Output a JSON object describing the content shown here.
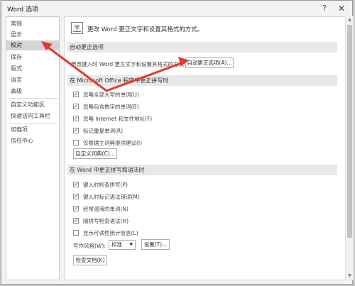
{
  "window": {
    "title": "Word 选项",
    "help_glyph": "?",
    "close_glyph": "✕"
  },
  "sidebar": {
    "items": [
      {
        "label": "常规"
      },
      {
        "label": "显示"
      },
      {
        "label": "校对"
      },
      {
        "label": "保存"
      },
      {
        "label": "版式"
      },
      {
        "label": "语言"
      },
      {
        "label": "高级"
      },
      {
        "label": "自定义功能区"
      },
      {
        "label": "快速访问工具栏"
      },
      {
        "label": "加载项"
      },
      {
        "label": "信任中心"
      }
    ],
    "selected": "校对"
  },
  "main": {
    "header_icon_text": "字",
    "header_text": "更改 Word 更正文字和设置其格式的方式。",
    "autocorrect": {
      "title": "自动更正选项",
      "desc": "更改键入时 Word 更正文字和设置其格式的方式：",
      "button": "自动更正选项(A)..."
    },
    "office": {
      "title": "在 Microsoft Office 程序中更正拼写时",
      "options": [
        {
          "label": "忽略全部大写的单词(U)",
          "checked": true
        },
        {
          "label": "忽略包含数字的单词(B)",
          "checked": true
        },
        {
          "label": "忽略 Internet 和文件地址(F)",
          "checked": true
        },
        {
          "label": "标记重复单词(R)",
          "checked": true
        },
        {
          "label": "仅根据主词典提供建议(I)",
          "checked": false
        }
      ],
      "custom_dict_button": "自定义词典(C)..."
    },
    "word": {
      "title": "在 Word 中更正拼写和语法时",
      "options": [
        {
          "label": "键入时检查拼写(P)",
          "checked": true
        },
        {
          "label": "键入时标记语法错误(M)",
          "checked": true
        },
        {
          "label": "经常混淆的单词(N)",
          "checked": true
        },
        {
          "label": "随拼写检查语法(H)",
          "checked": true
        },
        {
          "label": "显示可读性统计信息(L)",
          "checked": false
        }
      ],
      "style_label": "写作风格(W):",
      "style_value": "标准",
      "settings_button": "设置(T)...",
      "check_doc_button": "检查文档(K)"
    }
  },
  "scrollbar": {
    "up": "▲",
    "down": "▼"
  },
  "colors": {
    "annotation_red": "#e03a2f",
    "sidebar_selected": "#d4d4d4",
    "section_header_bg": "#e8e8e8"
  }
}
